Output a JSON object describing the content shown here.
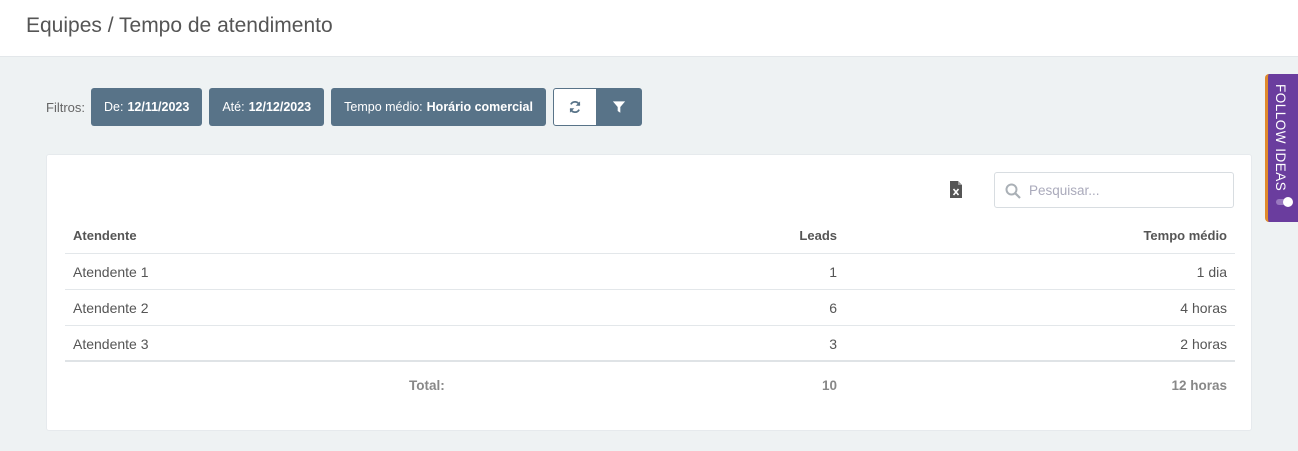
{
  "page": {
    "title": "Equipes / Tempo de atendimento"
  },
  "filters": {
    "label": "Filtros:",
    "from": {
      "label": "De:",
      "value": "12/11/2023"
    },
    "to": {
      "label": "Até:",
      "value": "12/12/2023"
    },
    "average": {
      "label": "Tempo médio:",
      "value": "Horário comercial"
    },
    "refresh_icon": "refresh-icon",
    "filter_icon": "filter-funnel-icon"
  },
  "toolbar": {
    "export_icon": "excel-file-icon",
    "search_placeholder": "Pesquisar..."
  },
  "table": {
    "headers": [
      "Atendente",
      "Leads",
      "Tempo médio"
    ],
    "rows": [
      [
        "Atendente 1",
        "1",
        "1 dia"
      ],
      [
        "Atendente 2",
        "6",
        "4 horas"
      ],
      [
        "Atendente 3",
        "3",
        "2 horas"
      ]
    ],
    "total": {
      "label": "Total:",
      "leads": "10",
      "time": "12 horas"
    }
  },
  "widget": {
    "label": "FOLLOW IDEAS"
  },
  "colors": {
    "accent": "#587388",
    "widget": "#6a3d9e",
    "widget_border": "#e08a2c",
    "background": "#eef2f3"
  }
}
